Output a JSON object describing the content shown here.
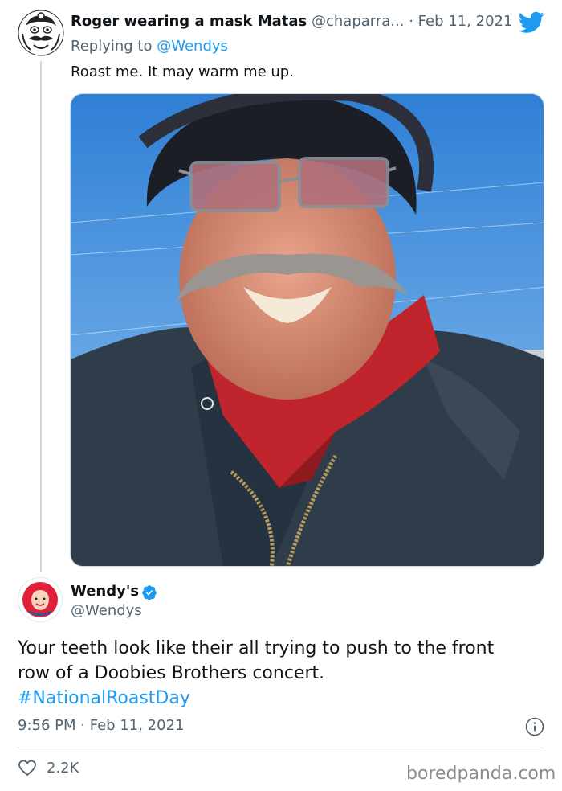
{
  "reply_tweet": {
    "display_name": "Roger wearing a mask Matas",
    "handle": "@chaparra...",
    "separator": "·",
    "date": "Feb 11, 2021",
    "replying_prefix": "Replying to",
    "replying_to": "@Wendys",
    "text": "Roast me. It may warm me up.",
    "avatar_icon": "cartoon-face-avatar",
    "brand_icon": "twitter-bird-icon"
  },
  "main_tweet": {
    "display_name": "Wendy's",
    "handle": "@Wendys",
    "verified_icon": "verified-badge-icon",
    "text_line1": "Your teeth look like their all trying to push to the front",
    "text_line2": "row of a Doobies Brothers concert.",
    "hashtag": "#NationalRoastDay",
    "time": "9:56 PM",
    "separator": "·",
    "date": "Feb 11, 2021",
    "likes": "2.2K",
    "avatar_icon": "wendys-logo-avatar"
  },
  "watermark": "boredpanda.com",
  "colors": {
    "text": "#0f1419",
    "muted": "#536471",
    "accent": "#1d9bf0",
    "border": "#cfd9de"
  }
}
